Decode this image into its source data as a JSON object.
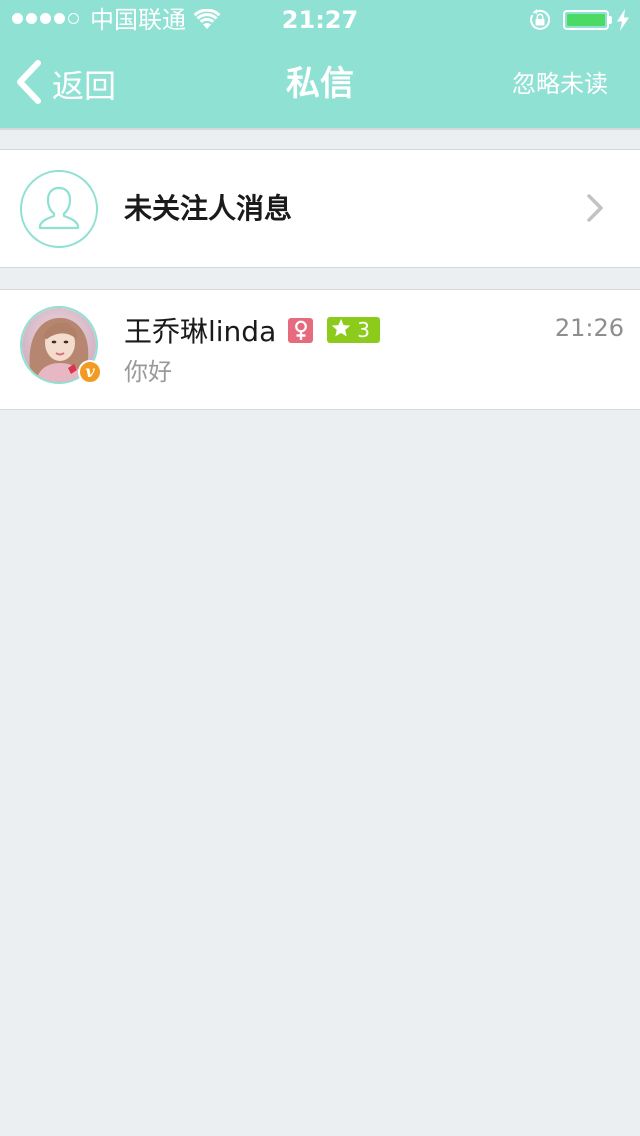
{
  "status_bar": {
    "carrier": "中国联通",
    "time": "21:27",
    "signal_bars": 4,
    "signal_total": 5,
    "battery_level": 1.0,
    "battery_color": "#4cd964"
  },
  "nav": {
    "back_label": "返回",
    "title": "私信",
    "right_action": "忽略未读",
    "background": "#8fe1d3"
  },
  "unfollowed": {
    "label": "未关注人消息",
    "icon": "person-icon"
  },
  "conversations": [
    {
      "name": "王乔琳linda",
      "gender": "female",
      "gender_symbol": "♀",
      "level": "3",
      "verified_badge": "v",
      "time": "21:26",
      "preview": "你好"
    }
  ],
  "colors": {
    "accent": "#8fe1d3",
    "female_badge": "#e76b7e",
    "level_badge": "#8ccb1c",
    "verify_badge": "#f39a22",
    "page_bg": "#eceff2"
  }
}
